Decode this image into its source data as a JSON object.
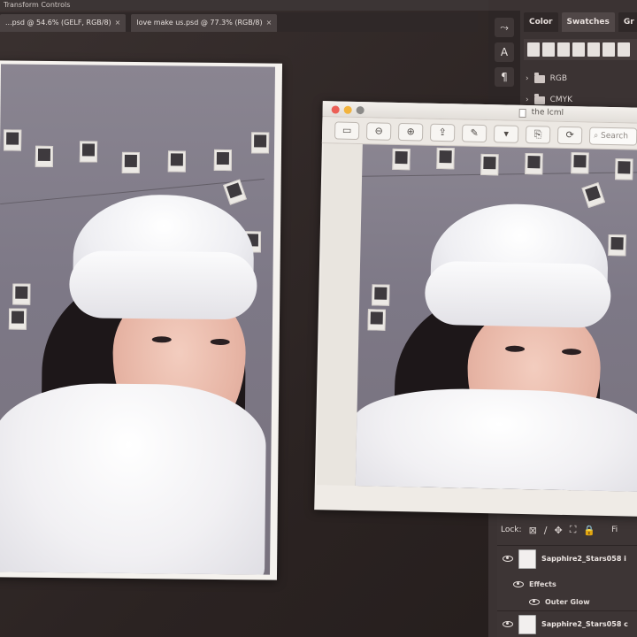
{
  "optionbar": {
    "text": "Transform Controls"
  },
  "tabs": [
    {
      "label": "...psd @ 54.6% (GELF, RGB/8)",
      "close": "×"
    },
    {
      "label": "love make us.psd @ 77.3% (RGB/8)",
      "close": "×"
    }
  ],
  "toolstrip": {
    "items": [
      "⤳",
      "A",
      "¶"
    ]
  },
  "panel": {
    "tabs": [
      "Color",
      "Swatches",
      "Gr"
    ],
    "folders": [
      {
        "name": "RGB"
      },
      {
        "name": "CMYK"
      }
    ]
  },
  "preview": {
    "title": "the lcml",
    "search_placeholder": "Search",
    "toolbar": [
      "▭ ▾",
      "⊖",
      "⊕",
      "⇪",
      "✎",
      "▾",
      "⎘",
      "⟳"
    ]
  },
  "layers": {
    "lock_label": "Lock:",
    "lock_icons": [
      "⊠",
      "∕",
      "✥",
      "⛶",
      "🔒"
    ],
    "fill_label": "Fi",
    "rows": [
      {
        "name": "Sapphire2_Stars058 i"
      },
      {
        "name": "Sapphire2_Stars058 c"
      }
    ],
    "effects_label": "Effects",
    "outer_glow_label": "Outer Glow"
  },
  "colors": {
    "background": "#2e2626",
    "panel": "#3b3333",
    "photo_wall": "#827d8a"
  }
}
